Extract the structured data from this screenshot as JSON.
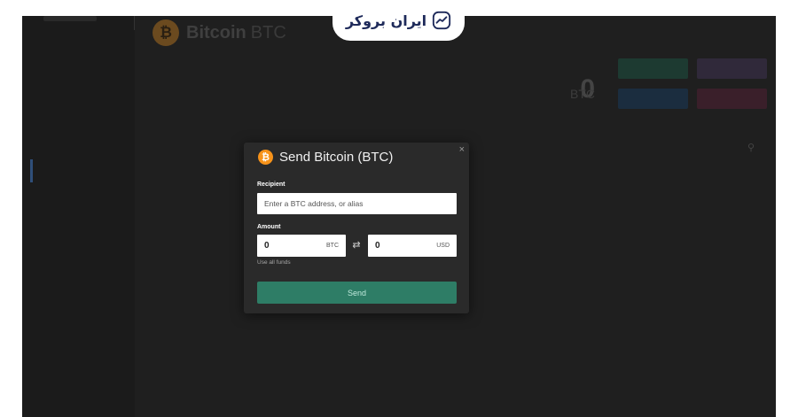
{
  "coin": {
    "name": "Bitcoin",
    "symbol": "BTC",
    "glyph": "₿"
  },
  "balance": {
    "amount": "0",
    "unit": "BTC"
  },
  "modal": {
    "title": "Send Bitcoin (BTC)",
    "close_glyph": "×",
    "recipient_label": "Recipient",
    "recipient_placeholder": "Enter a BTC address, or alias",
    "amount_label": "Amount",
    "amount_btc_value": "0",
    "amount_btc_unit": "BTC",
    "amount_usd_value": "0",
    "amount_usd_unit": "USD",
    "swap_glyph": "⇄",
    "use_all_funds": "Use all funds",
    "send_label": "Send"
  },
  "brand": {
    "name": "ایران بروکر"
  },
  "colors": {
    "accent_send": "#2e7d66",
    "btc_orange": "#f7931a",
    "brand_navy": "#1e2a5a"
  }
}
